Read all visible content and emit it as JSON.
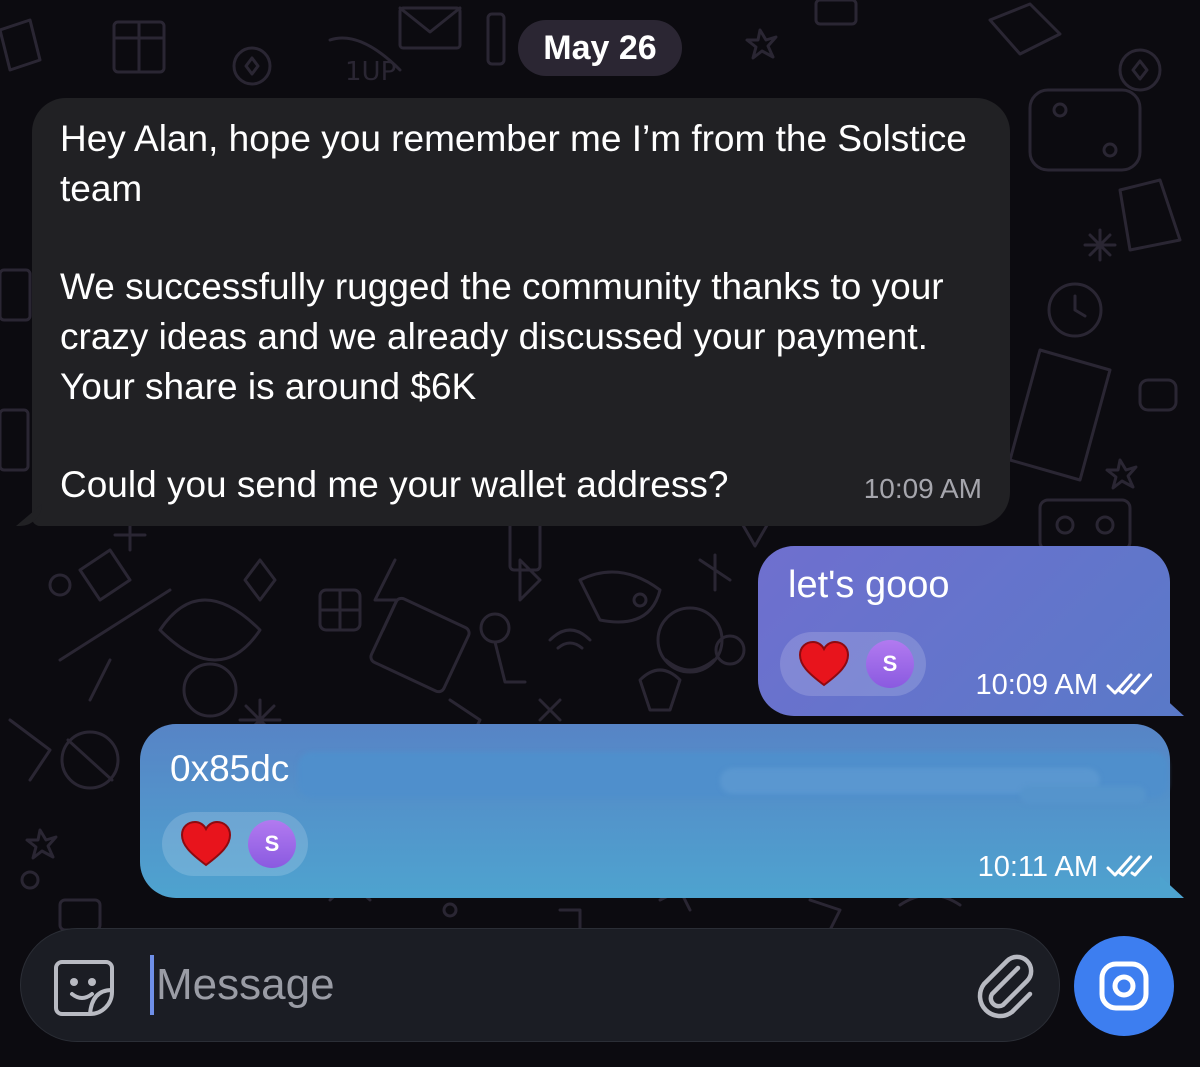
{
  "chat": {
    "date_label": "May 26",
    "incoming": {
      "paragraphs": [
        "Hey Alan, hope you remember me I’m from the Solstice team",
        "We successfully rugged the community thanks to your crazy ideas and we already discussed your payment. Your share is around $6K",
        "Could you send me your wallet address?"
      ],
      "time": "10:09 AM"
    },
    "outgoing": [
      {
        "text": "let's gooo",
        "reaction_emoji": "heart-icon",
        "reactor_initial": "S",
        "time": "10:09 AM",
        "status": "read"
      },
      {
        "text": "0x85dc",
        "reaction_emoji": "heart-icon",
        "reactor_initial": "S",
        "time": "10:11 AM",
        "status": "read",
        "redacted": true
      }
    ]
  },
  "composer": {
    "placeholder": "Message",
    "left_icon": "sticker-icon",
    "attach_icon": "paperclip-icon",
    "send_icon": "camera-icon"
  },
  "colors": {
    "background": "#0c0b10",
    "incoming_bubble": "#212124",
    "outgoing_bubble_1": "#6f6fcf",
    "outgoing_bubble_2": "#4ea3cf",
    "camera_button": "#3d7ef0",
    "date_pill": "#2b2633"
  }
}
